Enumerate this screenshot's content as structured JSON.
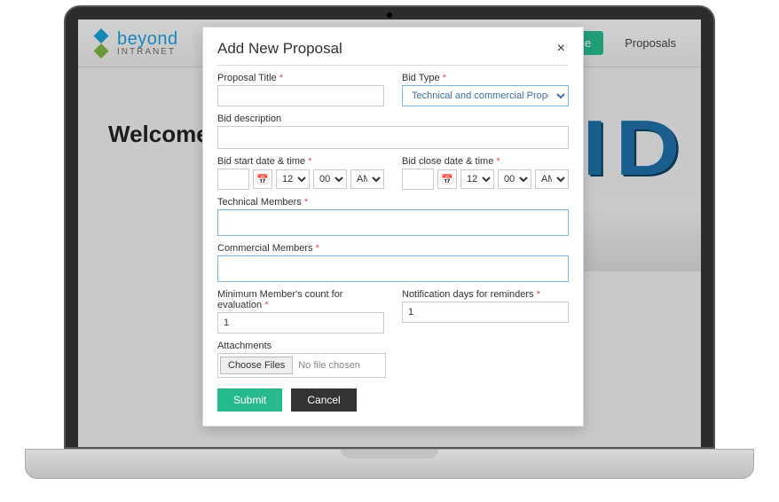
{
  "header": {
    "brand_main": "beyond",
    "brand_sub": "INTRANET",
    "nav_home": "Home",
    "nav_proposals": "Proposals"
  },
  "page": {
    "welcome_prefix": "Welcome to",
    "bg_letters": "ID"
  },
  "modal": {
    "title": "Add New Proposal",
    "close": "×",
    "labels": {
      "proposal_title": "Proposal Title",
      "bid_type": "Bid Type",
      "bid_description": "Bid description",
      "bid_start": "Bid start date & time",
      "bid_close": "Bid close date & time",
      "tech_members": "Technical Members",
      "comm_members": "Commercial Members",
      "min_count": "Minimum Member's count for evaluation",
      "notif_days": "Notification days for reminders",
      "attachments": "Attachments"
    },
    "bid_type_value": "Technical and commercial Proposal separately",
    "time": {
      "hour": "12",
      "minute": "00",
      "ampm": "AM"
    },
    "values": {
      "min_count": "1",
      "notif_days": "1"
    },
    "file": {
      "button": "Choose Files",
      "status": "No file chosen"
    },
    "actions": {
      "submit": "Submit",
      "cancel": "Cancel"
    },
    "required_marker": "*",
    "calendar_icon": "📅"
  }
}
